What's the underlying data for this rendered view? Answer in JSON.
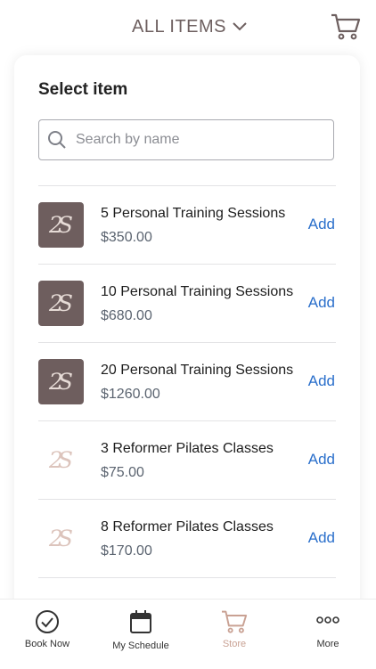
{
  "header": {
    "title": "ALL ITEMS",
    "dropdown_icon": "chevron-down-icon",
    "cart_icon": "cart-icon"
  },
  "panel": {
    "title": "Select item",
    "search": {
      "placeholder": "Search by name",
      "value": ""
    }
  },
  "items": [
    {
      "name": "5 Personal Training Sessions",
      "price": "$350.00",
      "action": "Add",
      "thumb": "dark",
      "logo_text": "2S"
    },
    {
      "name": "10 Personal Training Sessions",
      "price": "$680.00",
      "action": "Add",
      "thumb": "dark",
      "logo_text": "2S"
    },
    {
      "name": "20 Personal Training Sessions",
      "price": "$1260.00",
      "action": "Add",
      "thumb": "dark",
      "logo_text": "2S"
    },
    {
      "name": "3 Reformer Pilates Classes",
      "price": "$75.00",
      "action": "Add",
      "thumb": "light",
      "logo_text": "2S"
    },
    {
      "name": "8 Reformer Pilates Classes",
      "price": "$170.00",
      "action": "Add",
      "thumb": "light",
      "logo_text": "2S"
    }
  ],
  "nav": [
    {
      "label": "Book Now",
      "icon": "check-circle-icon"
    },
    {
      "label": "My Schedule",
      "icon": "calendar-icon"
    },
    {
      "label": "Store",
      "icon": "cart-icon",
      "active": true
    },
    {
      "label": "More",
      "icon": "more-dots-icon"
    }
  ],
  "colors": {
    "accent_blue": "#2a6fcb",
    "title_brown": "#6d5f5f",
    "thumb_dark": "#6e5e5e",
    "active_tab": "#c9a193"
  }
}
